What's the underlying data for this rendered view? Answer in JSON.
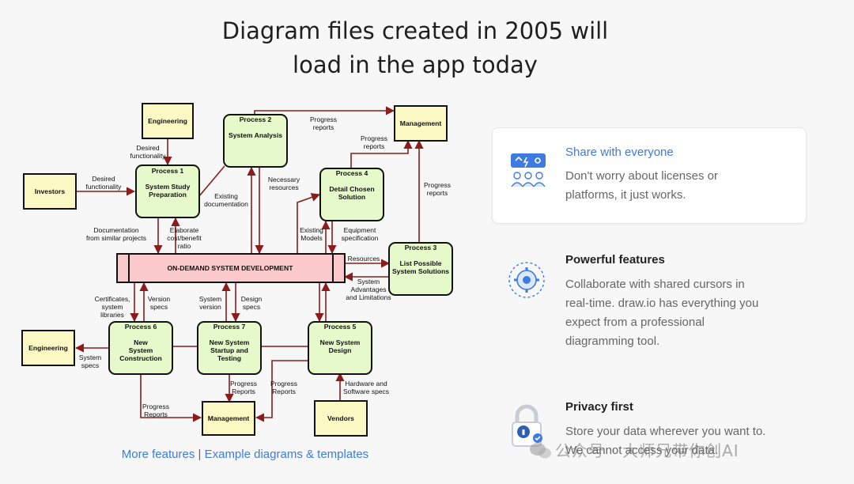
{
  "headline": {
    "line1": "Diagram files created in 2005 will",
    "line2": "load in the app today"
  },
  "diagram": {
    "entities": {
      "engineering_top": "Engineering",
      "investors": "Investors",
      "management_top": "Management",
      "engineering_left": "Engineering",
      "management_bottom": "Management",
      "vendors": "Vendors"
    },
    "store": "ON-DEMAND SYSTEM DEVELOPMENT",
    "processes": {
      "p1": {
        "num": "Process 1",
        "l1": "System Study",
        "l2": "Preparation",
        "l3": ""
      },
      "p2": {
        "num": "Process 2",
        "l1": "System Analysis",
        "l2": "",
        "l3": ""
      },
      "p3": {
        "num": "Process 3",
        "l1": "List Possible",
        "l2": "System Solutions",
        "l3": ""
      },
      "p4": {
        "num": "Process 4",
        "l1": "Detail Chosen",
        "l2": "Solution",
        "l3": ""
      },
      "p5": {
        "num": "Process 5",
        "l1": "New System",
        "l2": "Design",
        "l3": ""
      },
      "p6": {
        "num": "Process 6",
        "l1": "New",
        "l2": "System",
        "l3": "Construction"
      },
      "p7": {
        "num": "Process 7",
        "l1": "New System",
        "l2": "Startup and",
        "l3": "Testing"
      }
    },
    "labels": {
      "desired_func_1a": "Desired",
      "desired_func_1b": "functionality",
      "desired_func_2a": "Desired",
      "desired_func_2b": "functionality",
      "progress_reports_top_a": "Progress",
      "progress_reports_top_b": "reports",
      "progress_reports_p4_a": "Progress",
      "progress_reports_p4_b": "reports",
      "progress_reports_p3_a": "Progress",
      "progress_reports_p3_b": "reports",
      "necessary_res_a": "Necessary",
      "necessary_res_b": "resources",
      "existing_doc_a": "Existing",
      "existing_doc_b": "documentation",
      "doc_similar_a": "Documentation",
      "doc_similar_b": "from similar projects",
      "elaborate_a": "Elaborate",
      "elaborate_b": "cost/benefit",
      "elaborate_c": "ratio",
      "existing_models_a": "Existing",
      "existing_models_b": "Models",
      "equip_spec_a": "Equipment",
      "equip_spec_b": "specification",
      "resources": "Resources",
      "sys_adv_a": "System",
      "sys_adv_b": "Advantages",
      "sys_adv_c": "and Limitations",
      "certificates_a": "Certificates,",
      "certificates_b": "system",
      "certificates_c": "libraries",
      "version_specs_a": "Version",
      "version_specs_b": "specs",
      "system_version_a": "System",
      "system_version_b": "version",
      "design_specs_a": "Design",
      "design_specs_b": "specs",
      "system_specs_a": "System",
      "system_specs_b": "specs",
      "progress_p6_a": "Progress",
      "progress_p6_b": "Reports",
      "progress_p7_a": "Progress",
      "progress_p7_b": "Reports",
      "progress_p5_a": "Progress",
      "progress_p5_b": "Reports",
      "hardware_a": "Hardware and",
      "hardware_b": "Software specs"
    }
  },
  "links": {
    "more_features": "More features",
    "separator": "|",
    "examples": "Example diagrams & templates"
  },
  "features": [
    {
      "title": "Share with everyone",
      "line1": "Don't worry about licenses or",
      "line2": "platforms, it just works.",
      "icon": "share-icon"
    },
    {
      "title": "Powerful features",
      "line1": "Collaborate with shared cursors in",
      "line2": "real-time. draw.io has everything you",
      "line3": "expect from a professional",
      "line4": "diagramming tool.",
      "icon": "gear-icon"
    },
    {
      "title": "Privacy first",
      "line1": "Store your data wherever you want to.",
      "line2": "We cannot access your data.",
      "icon": "lock-icon"
    }
  ],
  "watermark": "公众号 · 大师兄带你创AI",
  "colors": {
    "accent": "#3d7be0",
    "arrow": "#8a1c1c",
    "process": "#e6f9cb",
    "entity": "#fdf9c5",
    "store": "#f9c9cc"
  }
}
